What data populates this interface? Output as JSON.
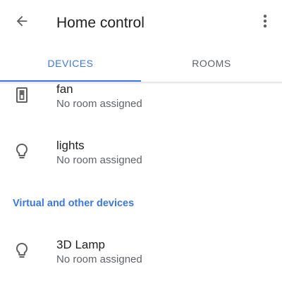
{
  "app_bar": {
    "back_icon": "arrow-back-icon",
    "title": "Home control",
    "more_icon": "more-vert-icon"
  },
  "tabs": [
    {
      "label": "DEVICES",
      "active": true
    },
    {
      "label": "ROOMS",
      "active": false
    }
  ],
  "devices": [
    {
      "name": "fan",
      "room": "No room assigned",
      "icon": "switch-icon"
    },
    {
      "name": "lights",
      "room": "No room assigned",
      "icon": "lightbulb-icon"
    }
  ],
  "virtual_section": {
    "title": "Virtual and other devices",
    "devices": [
      {
        "name": "3D Lamp",
        "room": "No room assigned",
        "icon": "lightbulb-icon"
      }
    ]
  },
  "colors": {
    "accent": "#3b78e7",
    "text_primary": "#212121",
    "text_secondary": "#5f6368",
    "icon": "#616161"
  }
}
